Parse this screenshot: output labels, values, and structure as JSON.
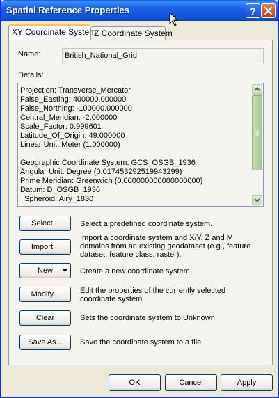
{
  "window": {
    "title": "Spatial Reference Properties"
  },
  "tabs": [
    {
      "label": "XY Coordinate System",
      "active": true
    },
    {
      "label": "Z Coordinate System",
      "active": false
    }
  ],
  "name": {
    "label": "Name:",
    "value": "British_National_Grid"
  },
  "details": {
    "label": "Details:",
    "lines": [
      "Projection: Transverse_Mercator",
      "False_Easting: 400000.000000",
      "False_Northing: -100000.000000",
      "Central_Meridian: -2.000000",
      "Scale_Factor: 0.999601",
      "Latitude_Of_Origin: 49.000000",
      "Linear Unit: Meter (1.000000)",
      "",
      "Geographic Coordinate System: GCS_OSGB_1936",
      "Angular Unit: Degree (0.017453292519943299)",
      "Prime Meridian: Greenwich (0.000000000000000000)",
      "Datum: D_OSGB_1936",
      "  Spheroid: Airy_1830"
    ]
  },
  "actions": [
    {
      "button": "Select...",
      "description": "Select a predefined coordinate system."
    },
    {
      "button": "Import...",
      "description": "Import a coordinate system and X/Y, Z and M domains from an existing geodataset (e.g., feature dataset, feature class, raster)."
    },
    {
      "button": "New",
      "description": "Create a new coordinate system."
    },
    {
      "button": "Modify...",
      "description": "Edit the properties of the currently selected coordinate system."
    },
    {
      "button": "Clear",
      "description": "Sets the coordinate system to Unknown."
    },
    {
      "button": "Save As...",
      "description": "Save the coordinate system to a file."
    }
  ],
  "footer": {
    "ok": "OK",
    "cancel": "Cancel",
    "apply": "Apply"
  }
}
